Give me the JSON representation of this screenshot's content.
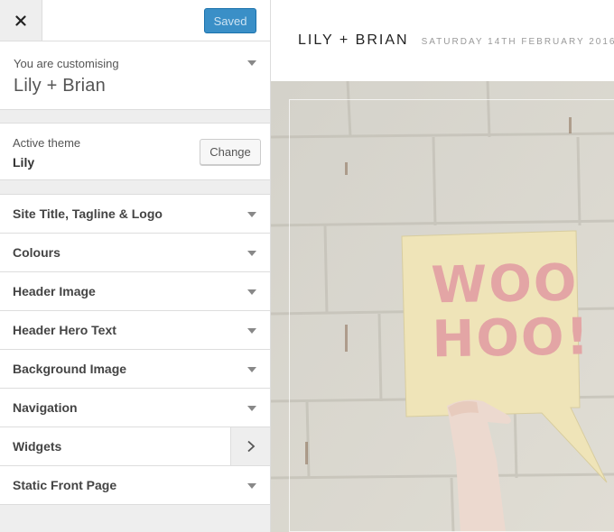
{
  "sidebar": {
    "close_icon": "close-icon",
    "saved_label": "Saved",
    "customising_label": "You are customising",
    "site_name": "Lily + Brian",
    "active_theme_label": "Active theme",
    "active_theme_name": "Lily",
    "change_label": "Change",
    "sections": [
      {
        "label": "Site Title, Tagline & Logo",
        "icon": "chevron-down-icon"
      },
      {
        "label": "Colours",
        "icon": "chevron-down-icon"
      },
      {
        "label": "Header Image",
        "icon": "chevron-down-icon"
      },
      {
        "label": "Header Hero Text",
        "icon": "chevron-down-icon"
      },
      {
        "label": "Background Image",
        "icon": "chevron-down-icon"
      },
      {
        "label": "Navigation",
        "icon": "chevron-down-icon"
      },
      {
        "label": "Widgets",
        "icon": "chevron-right-icon"
      },
      {
        "label": "Static Front Page",
        "icon": "chevron-down-icon"
      }
    ]
  },
  "preview": {
    "title": "LILY + BRIAN",
    "date": "SATURDAY 14TH FEBRUARY 2016",
    "sign_line1": "WOO",
    "sign_line2": "HOO!"
  },
  "colors": {
    "saved_button": "#3a8fc7",
    "sign": "#efe4b8",
    "sign_text": "#e3a5a5"
  }
}
